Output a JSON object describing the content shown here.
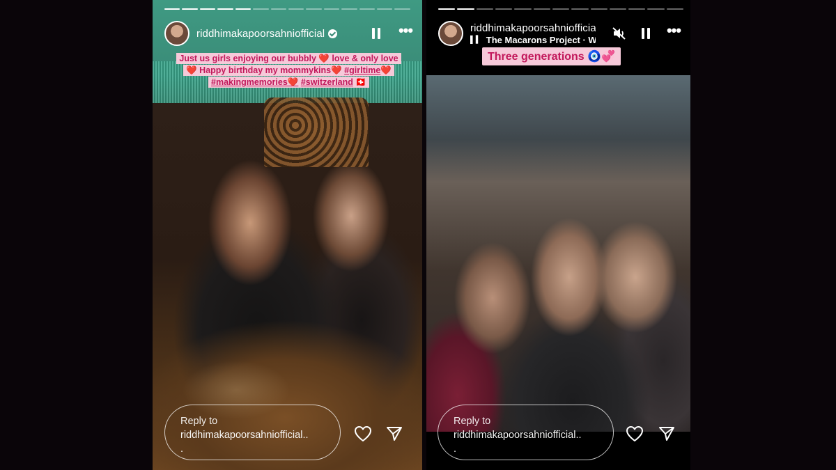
{
  "stories": {
    "left": {
      "username": "riddhimakapoorsahniofficial",
      "verified": true,
      "progress": {
        "total": 14,
        "completed": 5
      },
      "caption": {
        "lines": [
          "Just us girls enjoying our bubbly ❤️ love & only love",
          "❤️ Happy birthday my mommykins❤️",
          "#girltime",
          "❤️",
          "#makingmemories❤️",
          "#switzerland",
          "🇨🇭"
        ]
      },
      "reply": {
        "label": "Reply to",
        "user": "riddhimakapoorsahniofficial..",
        "extra": "."
      },
      "icons": {
        "pause": "pause-icon",
        "more": "more-options-icon",
        "heart": "heart-icon",
        "share": "send-icon"
      }
    },
    "right": {
      "username": "riddhimakapoorsahniofficial",
      "music": "The Macarons Project · Wh",
      "progress": {
        "total": 13,
        "completed": 2
      },
      "caption": "Three generations 🧿💞",
      "reply": {
        "label": "Reply to",
        "user": "riddhimakapoorsahniofficial..",
        "extra": "."
      },
      "icons": {
        "mute": "muted-speaker-icon",
        "pause": "pause-icon",
        "more": "more-options-icon",
        "heart": "heart-icon",
        "share": "send-icon"
      }
    }
  },
  "colors": {
    "caption_text": "#c2185b",
    "caption_bg": "#f6c9d9",
    "page_bg": "#0a0509"
  }
}
